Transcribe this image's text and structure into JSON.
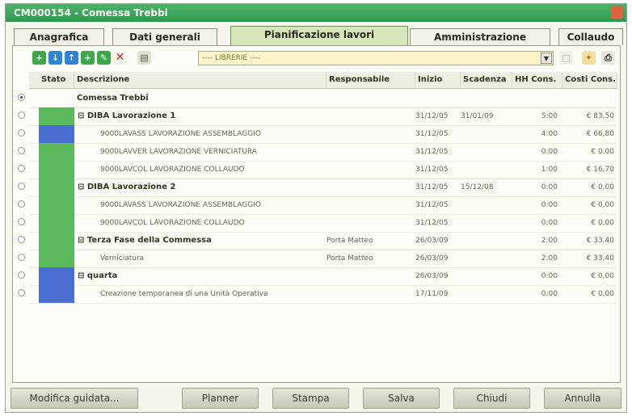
{
  "window": {
    "title": "CM000154 - Comessa Trebbi"
  },
  "tabs": [
    {
      "label": "Anagrafica"
    },
    {
      "label": "Dati generali"
    },
    {
      "label": "Pianificazione lavori",
      "active": true
    },
    {
      "label": "Amministrazione"
    },
    {
      "label": "Collaudo"
    }
  ],
  "toolbar": {
    "icons": [
      "add-icon",
      "move-down-icon",
      "move-up-icon",
      "add-child-icon",
      "edit-icon",
      "delete-icon",
      "print-preview-icon"
    ],
    "combo_value": "---- LIBRERIE ----"
  },
  "columns": {
    "stato": "Stato",
    "descrizione": "Descrizione",
    "responsabile": "Responsabile",
    "inizio": "Inizio",
    "scadenza": "Scadenza",
    "hh_cons": "HH Cons.",
    "costi_cons": "Costi Cons."
  },
  "rows": [
    {
      "descrizione": "Comessa Trebbi",
      "responsabile": "",
      "inizio": "",
      "scadenza": "",
      "hh": "",
      "costi": "",
      "color": "",
      "level": 0,
      "bold": true,
      "radio": true
    },
    {
      "descrizione": "DIBA Lavorazione 1",
      "responsabile": "",
      "inizio": "31/12/05",
      "scadenza": "31/01/09",
      "hh": "5:00",
      "costi": "€ 83,50",
      "color": "#5cb85c",
      "level": 1,
      "bold": true,
      "radio": false
    },
    {
      "descrizione": "9000LAVASS LAVORAZIONE ASSEMBLAGGIO",
      "responsabile": "",
      "inizio": "31/12/05",
      "scadenza": "",
      "hh": "4:00",
      "costi": "€ 66,80",
      "color": "#4a6fd0",
      "level": 2,
      "bold": false,
      "radio": false
    },
    {
      "descrizione": "9000LAVVER LAVORAZIONE VERNICIATURA",
      "responsabile": "",
      "inizio": "31/12/05",
      "scadenza": "",
      "hh": "0:00",
      "costi": "€ 0,00",
      "color": "#5cb85c",
      "level": 2,
      "bold": false,
      "radio": false
    },
    {
      "descrizione": "9000LAVCOL LAVORAZIONE COLLAUDO",
      "responsabile": "",
      "inizio": "31/12/05",
      "scadenza": "",
      "hh": "1:00",
      "costi": "€ 16,70",
      "color": "#5cb85c",
      "level": 2,
      "bold": false,
      "radio": false
    },
    {
      "descrizione": "DIBA Lavorazione 2",
      "responsabile": "",
      "inizio": "31/12/05",
      "scadenza": "15/12/08",
      "hh": "0:00",
      "costi": "€ 0,00",
      "color": "#5cb85c",
      "level": 1,
      "bold": true,
      "radio": false
    },
    {
      "descrizione": "9000LAVASS LAVORAZIONE ASSEMBLAGGIO",
      "responsabile": "",
      "inizio": "31/12/05",
      "scadenza": "",
      "hh": "0:00",
      "costi": "€ 0,00",
      "color": "#5cb85c",
      "level": 2,
      "bold": false,
      "radio": false
    },
    {
      "descrizione": "9000LAVCOL LAVORAZIONE COLLAUDO",
      "responsabile": "",
      "inizio": "31/12/05",
      "scadenza": "",
      "hh": "0:00",
      "costi": "€ 0,00",
      "color": "#5cb85c",
      "level": 2,
      "bold": false,
      "radio": false
    },
    {
      "descrizione": "Terza Fase della Commessa",
      "responsabile": "Porta Matteo",
      "inizio": "26/03/09",
      "scadenza": "",
      "hh": "2:00",
      "costi": "€ 33,40",
      "color": "#5cb85c",
      "level": 1,
      "bold": true,
      "radio": false
    },
    {
      "descrizione": "Verniciatura",
      "responsabile": "Porta Matteo",
      "inizio": "26/03/09",
      "scadenza": "",
      "hh": "2:00",
      "costi": "€ 33,40",
      "color": "#5cb85c",
      "level": 2,
      "bold": false,
      "radio": false
    },
    {
      "descrizione": "quarta",
      "responsabile": "",
      "inizio": "26/03/09",
      "scadenza": "",
      "hh": "0:00",
      "costi": "€ 0,00",
      "color": "#4a6fd0",
      "level": 1,
      "bold": true,
      "radio": false
    },
    {
      "descrizione": "Creazione temporanea di una Unità Operativa",
      "responsabile": "",
      "inizio": "17/11/09",
      "scadenza": "",
      "hh": "0:00",
      "costi": "€ 0,00",
      "color": "#4a6fd0",
      "level": 2,
      "bold": false,
      "radio": false
    }
  ],
  "buttons": {
    "modifica": "Modifica guidata...",
    "planner": "Planner",
    "stampa": "Stampa",
    "salva": "Salva",
    "chiudi": "Chiudi",
    "annulla": "Annulla"
  }
}
